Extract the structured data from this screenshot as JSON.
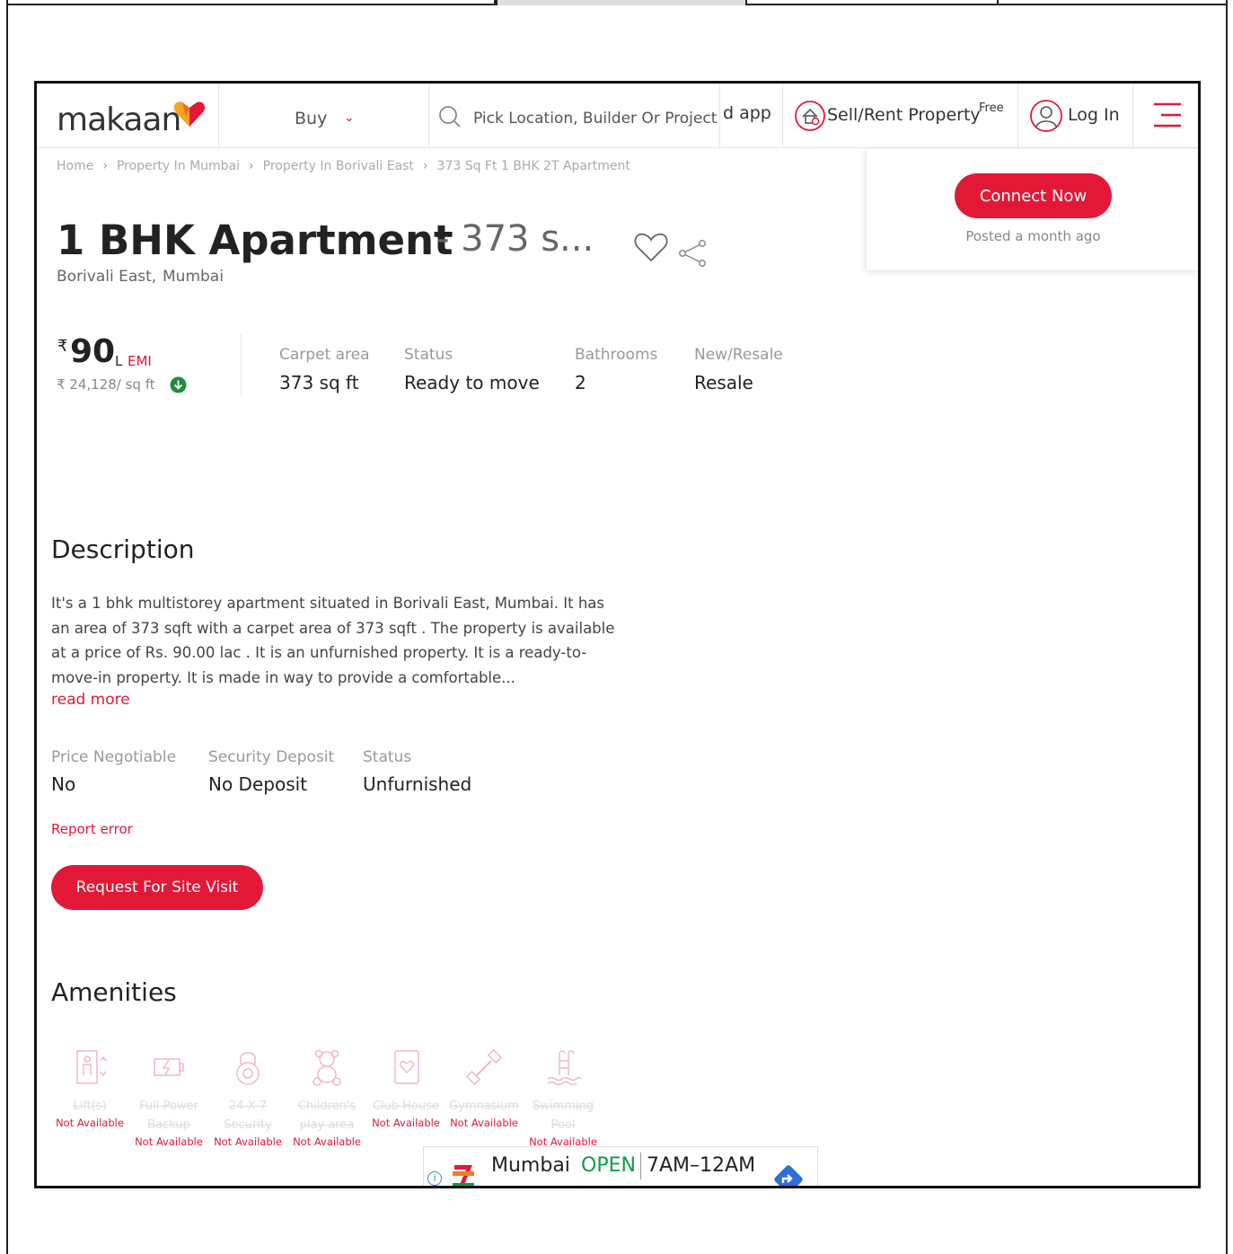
{
  "header": {
    "logo_text": "makaan",
    "buy_label": "Buy",
    "search_placeholder": "Pick Location, Builder Or Project",
    "app_text": "d app",
    "sell_label": "Sell/Rent Property",
    "sell_badge": "Free",
    "login_label": "Log In"
  },
  "breadcrumb": [
    "Home",
    "Property In Mumbai",
    "Property In Borivali East",
    "373 Sq Ft 1 BHK 2T Apartment"
  ],
  "connect": {
    "button_label": "Connect Now",
    "posted": "Posted a month ago"
  },
  "listing": {
    "title": "1 BHK Apartment",
    "title_sub": "- 373 s...",
    "locality": "Borivali East,",
    "city": "Mumbai",
    "currency_symbol": "₹",
    "price": "90",
    "price_unit": "L",
    "emi_label": "EMI",
    "rate": "₹ 24,128/ sq ft"
  },
  "specs": [
    {
      "label": "Carpet area",
      "value": "373 sq ft"
    },
    {
      "label": "Status",
      "value": "Ready to move"
    },
    {
      "label": "Bathrooms",
      "value": "2"
    },
    {
      "label": "New/Resale",
      "value": "Resale"
    }
  ],
  "description": {
    "heading": "Description",
    "text": "It's a 1 bhk multistorey apartment situated in Borivali East, Mumbai. It has an area of 373 sqft with a carpet area of 373 sqft . The property is available at a price of Rs. 90.00 lac . It is an unfurnished property. It is a ready-to-move-in property. It is made in way to provide a comfortable...",
    "read_more": "read more"
  },
  "details": [
    {
      "label": "Price Negotiable",
      "value": "No"
    },
    {
      "label": "Security Deposit",
      "value": "No Deposit"
    },
    {
      "label": "Status",
      "value": "Unfurnished"
    }
  ],
  "report_error": "Report error",
  "site_visit_button": "Request For Site Visit",
  "amenities": {
    "heading": "Amenities",
    "items": [
      {
        "name": "Lift(s)",
        "status": "Not Available",
        "icon": "lift-icon"
      },
      {
        "name": "Full Power Backup",
        "status": "Not Available",
        "icon": "power-backup-icon"
      },
      {
        "name": "24 X 7 Security",
        "status": "Not Available",
        "icon": "security-icon"
      },
      {
        "name": "Children's play area",
        "status": "Not Available",
        "icon": "play-area-icon"
      },
      {
        "name": "Club House",
        "status": "Not Available",
        "icon": "club-house-icon"
      },
      {
        "name": "Gymnasium",
        "status": "Not Available",
        "icon": "gymnasium-icon"
      },
      {
        "name": "Swimming Pool",
        "status": "Not Available",
        "icon": "swimming-pool-icon"
      }
    ]
  },
  "ad": {
    "city": "Mumbai",
    "open": "OPEN",
    "hours": "7AM–12AM"
  },
  "colors": {
    "brand_red": "#e31837",
    "green": "#1e8e3e"
  }
}
